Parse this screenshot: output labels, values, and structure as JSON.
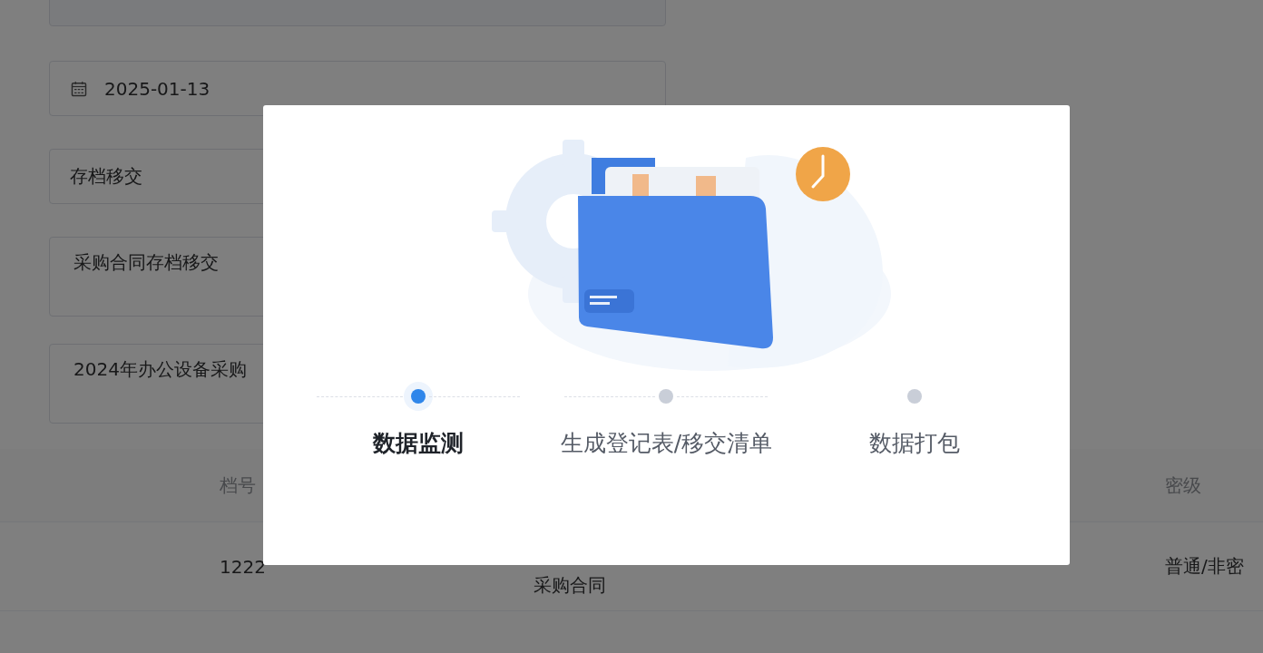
{
  "form": {
    "date": "2025-01-13",
    "type": "存档移交",
    "title": "采购合同存档移交",
    "description": "2024年办公设备采购"
  },
  "table": {
    "columns": [
      "档号",
      "",
      "密级"
    ],
    "rows": [
      {
        "cells": [
          "1222",
          "采购合同",
          "普通/非密"
        ]
      }
    ]
  },
  "dialog": {
    "steps": [
      {
        "label": "数据监测",
        "selected": true
      },
      {
        "label": "生成登记表/移交清单",
        "selected": false
      },
      {
        "label": "数据打包",
        "selected": false
      }
    ]
  }
}
